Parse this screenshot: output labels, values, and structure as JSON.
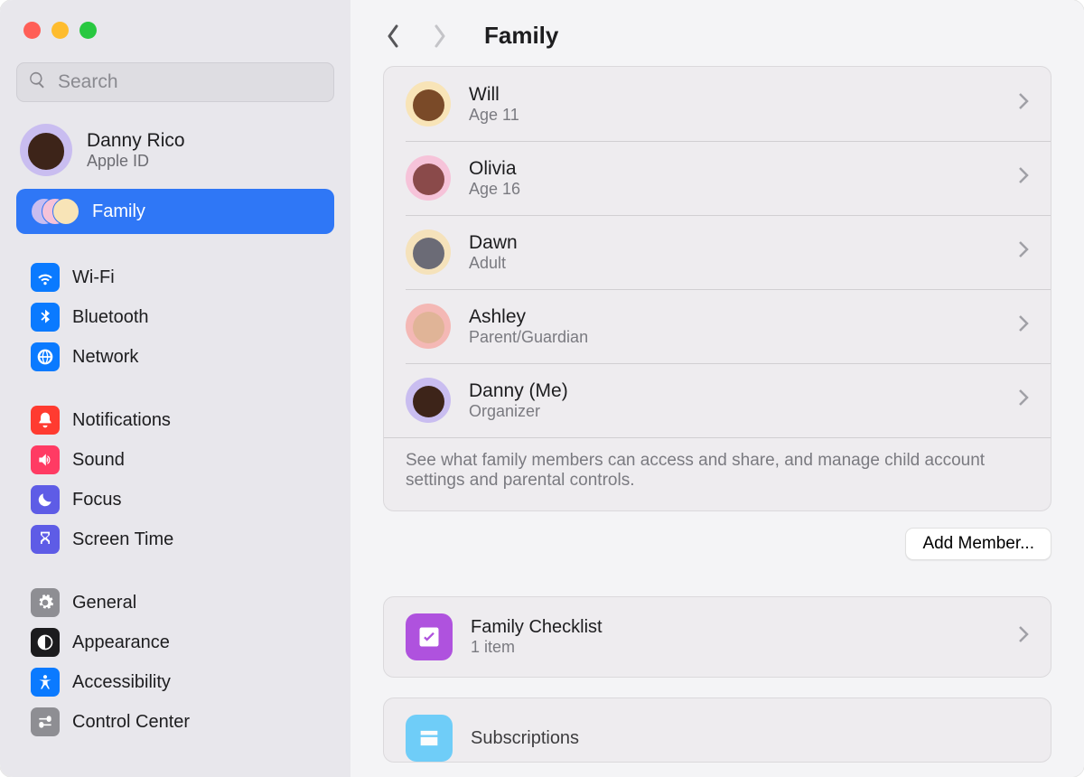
{
  "search": {
    "placeholder": "Search"
  },
  "account": {
    "name": "Danny Rico",
    "sub": "Apple ID",
    "avatar_bg": "#c9bdf0",
    "avatar_face": "#3d2419"
  },
  "sidebar": {
    "family": {
      "label": "Family"
    },
    "groups": [
      {
        "items": [
          {
            "label": "Wi-Fi",
            "bg": "#0a7aff",
            "icon": "wifi"
          },
          {
            "label": "Bluetooth",
            "bg": "#0a7aff",
            "icon": "bt"
          },
          {
            "label": "Network",
            "bg": "#0a7aff",
            "icon": "globe"
          }
        ]
      },
      {
        "items": [
          {
            "label": "Notifications",
            "bg": "#ff3b30",
            "icon": "bell"
          },
          {
            "label": "Sound",
            "bg": "#ff3b63",
            "icon": "speaker"
          },
          {
            "label": "Focus",
            "bg": "#5e5ce6",
            "icon": "moon"
          },
          {
            "label": "Screen Time",
            "bg": "#5e5ce6",
            "icon": "hourglass"
          }
        ]
      },
      {
        "items": [
          {
            "label": "General",
            "bg": "#8e8e93",
            "icon": "gear"
          },
          {
            "label": "Appearance",
            "bg": "#1c1c1e",
            "icon": "appearance"
          },
          {
            "label": "Accessibility",
            "bg": "#0a7aff",
            "icon": "acc"
          },
          {
            "label": "Control Center",
            "bg": "#8e8e93",
            "icon": "cc"
          }
        ]
      }
    ]
  },
  "header": {
    "title": "Family"
  },
  "members": [
    {
      "name": "Will",
      "sub": "Age 11",
      "bg": "#f8e4b7",
      "face": "#7a4a28"
    },
    {
      "name": "Olivia",
      "sub": "Age 16",
      "bg": "#f6c3d9",
      "face": "#8a4a4a"
    },
    {
      "name": "Dawn",
      "sub": "Adult",
      "bg": "#f5e2bb",
      "face": "#6b6b76"
    },
    {
      "name": "Ashley",
      "sub": "Parent/Guardian",
      "bg": "#f4b8b5",
      "face": "#e0b497"
    },
    {
      "name": "Danny (Me)",
      "sub": "Organizer",
      "bg": "#c9bdf0",
      "face": "#3d2419"
    }
  ],
  "family_footer": "See what family members can access and share, and manage child account settings and parental controls.",
  "actions": {
    "add_member": "Add Member..."
  },
  "checklist": {
    "title": "Family Checklist",
    "sub": "1 item",
    "icon_bg": "#af52de"
  },
  "subscriptions": {
    "title": "Subscriptions",
    "icon_bg": "#5ac8fa"
  }
}
